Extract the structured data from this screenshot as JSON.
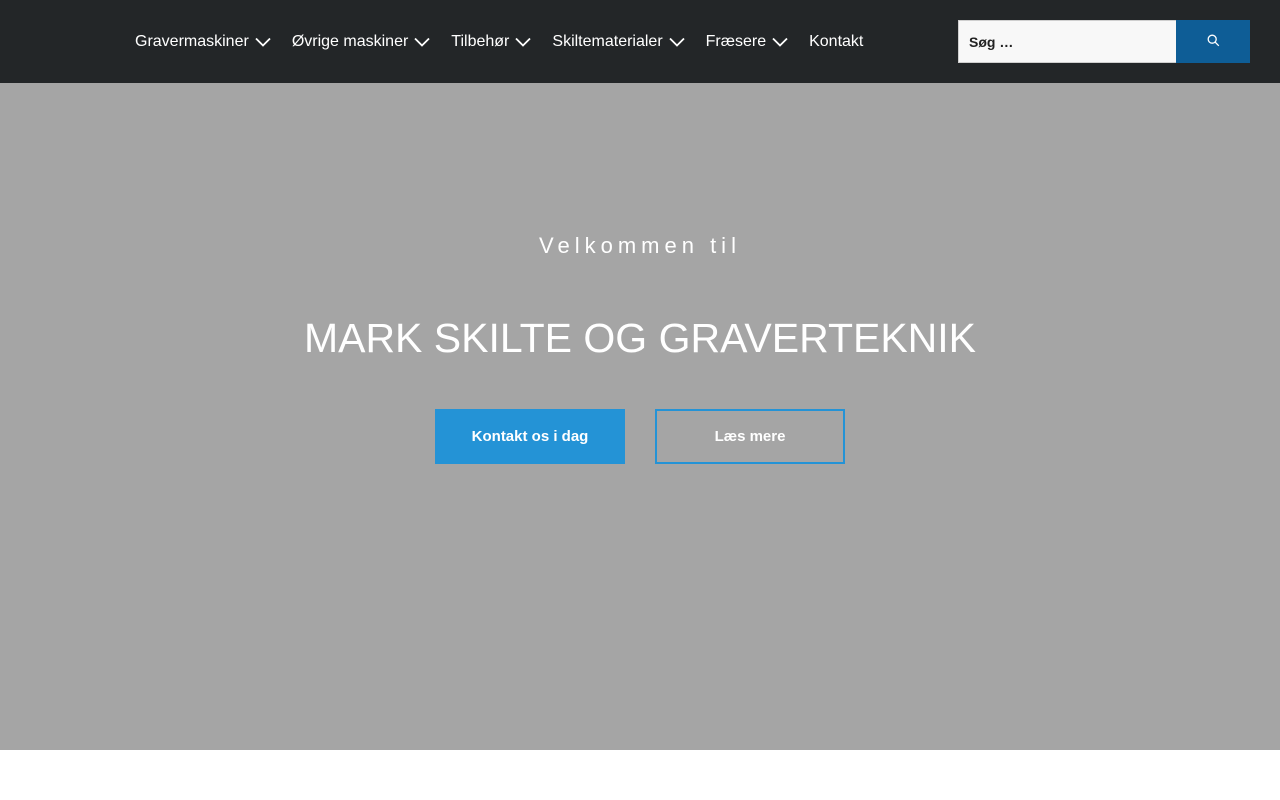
{
  "nav": {
    "items": [
      {
        "label": "Gravermaskiner",
        "has_dropdown": true
      },
      {
        "label": "Øvrige maskiner",
        "has_dropdown": true
      },
      {
        "label": "Tilbehør",
        "has_dropdown": true
      },
      {
        "label": "Skiltematerialer",
        "has_dropdown": true
      },
      {
        "label": "Fræsere",
        "has_dropdown": true
      },
      {
        "label": "Kontakt",
        "has_dropdown": false
      }
    ],
    "dropdown_icon": "chevron-down-icon"
  },
  "search": {
    "placeholder": "Søg …",
    "button_icon": "search-icon"
  },
  "hero": {
    "kicker": "Velkommen til",
    "title": "MARK SKILTE OG GRAVERTEKNIK",
    "primary_button": "Kontakt os i dag",
    "secondary_button": "Læs mere"
  },
  "colors": {
    "header_bg": "#232628",
    "hero_bg": "#a5a5a5",
    "accent": "#2493d6",
    "search_button": "#0e5d96"
  }
}
